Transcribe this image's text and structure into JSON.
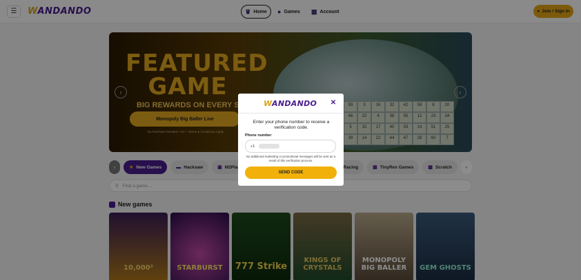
{
  "header": {
    "menu_icon": "hamburger-icon",
    "logo_text": "ANDANDO",
    "logo_w": "W",
    "nav": [
      {
        "label": "Home",
        "icon": "crown-icon"
      },
      {
        "label": "Games",
        "icon": "games-icon"
      },
      {
        "label": "Account",
        "icon": "account-icon"
      }
    ],
    "join_label": "Join / Sign In"
  },
  "hero": {
    "title": "FEATURED GAME",
    "subtitle": "BIG REWARDS ON EVERY SPIN",
    "button_label": "Monopoly Big Baller Live",
    "legal": "No Purchase Needed • 18+ • Terms & Conditions Apply",
    "board_numbers": [
      "59",
      "3",
      "16",
      "32",
      "42",
      "59",
      "8",
      "20",
      "46",
      "22",
      "4",
      "38",
      "55",
      "12",
      "23",
      "34",
      "5",
      "15",
      "17",
      "40",
      "53",
      "14",
      "51",
      "25",
      "39",
      "14",
      "22",
      "44",
      "47",
      "28",
      "60",
      "7"
    ]
  },
  "chips": [
    {
      "label": "New Games",
      "icon": "star-icon",
      "active": true
    },
    {
      "label": "Hacksaw",
      "icon": "hacksaw-icon"
    },
    {
      "label": "M2Play",
      "icon": "m2play-icon"
    },
    {
      "label": "Racing",
      "icon": "trophy-icon"
    },
    {
      "label": "TinyRex Games",
      "icon": "grid-icon"
    },
    {
      "label": "Scratch",
      "icon": "scratch-icon"
    }
  ],
  "search": {
    "placeholder": "Find a game..."
  },
  "section": {
    "title": "New games"
  },
  "tiles": [
    {
      "label": "10,000²"
    },
    {
      "label": "STARBURST"
    },
    {
      "label": "777 Strike"
    },
    {
      "label": "KINGS OF CRYSTALS"
    },
    {
      "label": "MONOPOLY BIG BALLER"
    },
    {
      "label": "GEM GHOSTS"
    }
  ],
  "modal": {
    "logo_text": "ANDANDO",
    "logo_w": "W",
    "instruction": "Enter your phone number to receive a verification code.",
    "phone_label": "Phone number",
    "country_code": "+1",
    "disclaimer": "No additional marketing or promotional messages will be sent as a result of this verification process.",
    "send_label": "SEND CODE",
    "close_icon": "close-icon"
  },
  "colors": {
    "brand_purple": "#4a1c8c",
    "accent_gold": "#e3a514",
    "button_gold": "#f1b10a"
  }
}
